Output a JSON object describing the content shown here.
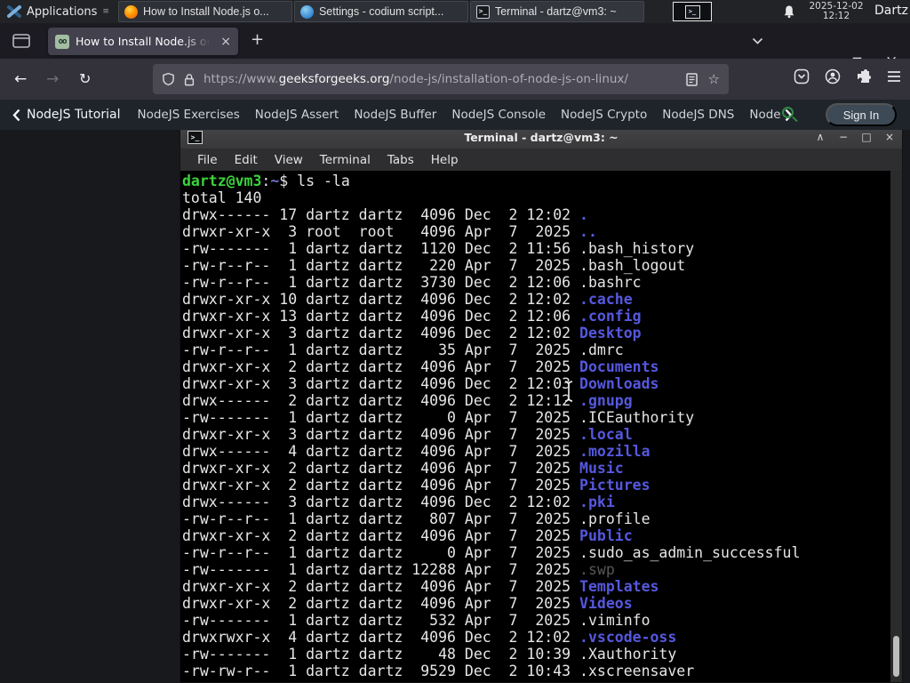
{
  "panel": {
    "applications_label": "Applications",
    "tasks": [
      {
        "icon": "firefox",
        "label": "How to Install Node.js o..."
      },
      {
        "icon": "codium",
        "label": "Settings - codium script..."
      },
      {
        "icon": "terminal",
        "label": "Terminal - dartz@vm3: ~"
      }
    ],
    "clock_date": "2025-12-02",
    "clock_time": "12:12",
    "user_label": "Dartz"
  },
  "browser": {
    "tab_title": "How to Install Node.js on",
    "url_prefix": "https://www.",
    "url_domain": "geeksforgeeks.org",
    "url_path": "/node-js/installation-of-node-js-on-linux/"
  },
  "site_nav": {
    "back_label": "NodeJS Tutorial",
    "links": [
      "NodeJS Exercises",
      "NodeJS Assert",
      "NodeJS Buffer",
      "NodeJS Console",
      "NodeJS Crypto",
      "NodeJS DNS",
      "Node"
    ],
    "sign_in_label": "Sign In"
  },
  "terminal": {
    "title": "Terminal - dartz@vm3: ~",
    "menu": [
      "File",
      "Edit",
      "View",
      "Terminal",
      "Tabs",
      "Help"
    ],
    "prompt_user": "dartz@vm3",
    "prompt_sep": ":",
    "prompt_path": "~",
    "prompt_tail": "$ ls -la",
    "total_line": "total 140",
    "listing": [
      {
        "perm": "drwx------",
        "links": "17",
        "owner": "dartz",
        "group": "dartz",
        "size": "4096",
        "date": "Dec  2 12:02",
        "name": ".",
        "type": "dir"
      },
      {
        "perm": "drwxr-xr-x",
        "links": "3",
        "owner": "root",
        "group": "root",
        "size": "4096",
        "date": "Apr  7  2025",
        "name": "..",
        "type": "dir"
      },
      {
        "perm": "-rw-------",
        "links": "1",
        "owner": "dartz",
        "group": "dartz",
        "size": "1120",
        "date": "Dec  2 11:56",
        "name": ".bash_history",
        "type": "file"
      },
      {
        "perm": "-rw-r--r--",
        "links": "1",
        "owner": "dartz",
        "group": "dartz",
        "size": "220",
        "date": "Apr  7  2025",
        "name": ".bash_logout",
        "type": "file"
      },
      {
        "perm": "-rw-r--r--",
        "links": "1",
        "owner": "dartz",
        "group": "dartz",
        "size": "3730",
        "date": "Dec  2 12:06",
        "name": ".bashrc",
        "type": "file"
      },
      {
        "perm": "drwxr-xr-x",
        "links": "10",
        "owner": "dartz",
        "group": "dartz",
        "size": "4096",
        "date": "Dec  2 12:02",
        "name": ".cache",
        "type": "dir"
      },
      {
        "perm": "drwxr-xr-x",
        "links": "13",
        "owner": "dartz",
        "group": "dartz",
        "size": "4096",
        "date": "Dec  2 12:06",
        "name": ".config",
        "type": "dir"
      },
      {
        "perm": "drwxr-xr-x",
        "links": "3",
        "owner": "dartz",
        "group": "dartz",
        "size": "4096",
        "date": "Dec  2 12:02",
        "name": "Desktop",
        "type": "dir"
      },
      {
        "perm": "-rw-r--r--",
        "links": "1",
        "owner": "dartz",
        "group": "dartz",
        "size": "35",
        "date": "Apr  7  2025",
        "name": ".dmrc",
        "type": "file"
      },
      {
        "perm": "drwxr-xr-x",
        "links": "2",
        "owner": "dartz",
        "group": "dartz",
        "size": "4096",
        "date": "Apr  7  2025",
        "name": "Documents",
        "type": "dir"
      },
      {
        "perm": "drwxr-xr-x",
        "links": "3",
        "owner": "dartz",
        "group": "dartz",
        "size": "4096",
        "date": "Dec  2 12:03",
        "name": "Downloads",
        "type": "dir"
      },
      {
        "perm": "drwx------",
        "links": "2",
        "owner": "dartz",
        "group": "dartz",
        "size": "4096",
        "date": "Dec  2 12:12",
        "name": ".gnupg",
        "type": "dir"
      },
      {
        "perm": "-rw-------",
        "links": "1",
        "owner": "dartz",
        "group": "dartz",
        "size": "0",
        "date": "Apr  7  2025",
        "name": ".ICEauthority",
        "type": "file"
      },
      {
        "perm": "drwxr-xr-x",
        "links": "3",
        "owner": "dartz",
        "group": "dartz",
        "size": "4096",
        "date": "Apr  7  2025",
        "name": ".local",
        "type": "dir"
      },
      {
        "perm": "drwx------",
        "links": "4",
        "owner": "dartz",
        "group": "dartz",
        "size": "4096",
        "date": "Apr  7  2025",
        "name": ".mozilla",
        "type": "dir"
      },
      {
        "perm": "drwxr-xr-x",
        "links": "2",
        "owner": "dartz",
        "group": "dartz",
        "size": "4096",
        "date": "Apr  7  2025",
        "name": "Music",
        "type": "dir"
      },
      {
        "perm": "drwxr-xr-x",
        "links": "2",
        "owner": "dartz",
        "group": "dartz",
        "size": "4096",
        "date": "Apr  7  2025",
        "name": "Pictures",
        "type": "dir"
      },
      {
        "perm": "drwx------",
        "links": "3",
        "owner": "dartz",
        "group": "dartz",
        "size": "4096",
        "date": "Dec  2 12:02",
        "name": ".pki",
        "type": "dir"
      },
      {
        "perm": "-rw-r--r--",
        "links": "1",
        "owner": "dartz",
        "group": "dartz",
        "size": "807",
        "date": "Apr  7  2025",
        "name": ".profile",
        "type": "file"
      },
      {
        "perm": "drwxr-xr-x",
        "links": "2",
        "owner": "dartz",
        "group": "dartz",
        "size": "4096",
        "date": "Apr  7  2025",
        "name": "Public",
        "type": "dir"
      },
      {
        "perm": "-rw-r--r--",
        "links": "1",
        "owner": "dartz",
        "group": "dartz",
        "size": "0",
        "date": "Apr  7  2025",
        "name": ".sudo_as_admin_successful",
        "type": "file"
      },
      {
        "perm": "-rw-------",
        "links": "1",
        "owner": "dartz",
        "group": "dartz",
        "size": "12288",
        "date": "Apr  7  2025",
        "name": ".swp",
        "type": "dim"
      },
      {
        "perm": "drwxr-xr-x",
        "links": "2",
        "owner": "dartz",
        "group": "dartz",
        "size": "4096",
        "date": "Apr  7  2025",
        "name": "Templates",
        "type": "dir"
      },
      {
        "perm": "drwxr-xr-x",
        "links": "2",
        "owner": "dartz",
        "group": "dartz",
        "size": "4096",
        "date": "Apr  7  2025",
        "name": "Videos",
        "type": "dir"
      },
      {
        "perm": "-rw-------",
        "links": "1",
        "owner": "dartz",
        "group": "dartz",
        "size": "532",
        "date": "Apr  7  2025",
        "name": ".viminfo",
        "type": "file"
      },
      {
        "perm": "drwxrwxr-x",
        "links": "4",
        "owner": "dartz",
        "group": "dartz",
        "size": "4096",
        "date": "Dec  2 12:02",
        "name": ".vscode-oss",
        "type": "dir"
      },
      {
        "perm": "-rw-------",
        "links": "1",
        "owner": "dartz",
        "group": "dartz",
        "size": "48",
        "date": "Dec  2 10:39",
        "name": ".Xauthority",
        "type": "file"
      },
      {
        "perm": "-rw-rw-r--",
        "links": "1",
        "owner": "dartz",
        "group": "dartz",
        "size": "9529",
        "date": "Dec  2 10:43",
        "name": ".xscreensaver",
        "type": "file"
      }
    ]
  },
  "icons": {
    "apps_menu": "≡",
    "terminal_glyph": ">_",
    "favicon_text": "oo",
    "new_tab": "+",
    "back": "←",
    "forward": "→",
    "reload": "↻",
    "star": "☆",
    "tab_close": "×",
    "window_close": "×",
    "term_rollup": "∧",
    "term_minimize": "−",
    "term_maximize": "□",
    "term_close": "×"
  },
  "colors": {
    "gfg_green": "#2f8d46",
    "dir_blue": "#5558dd",
    "prompt_green": "#3bd23b",
    "dim_file_gray": "#585858",
    "panel_bg": "#212327",
    "tab_bg": "#42414d",
    "terminal_bg": "#000000"
  }
}
